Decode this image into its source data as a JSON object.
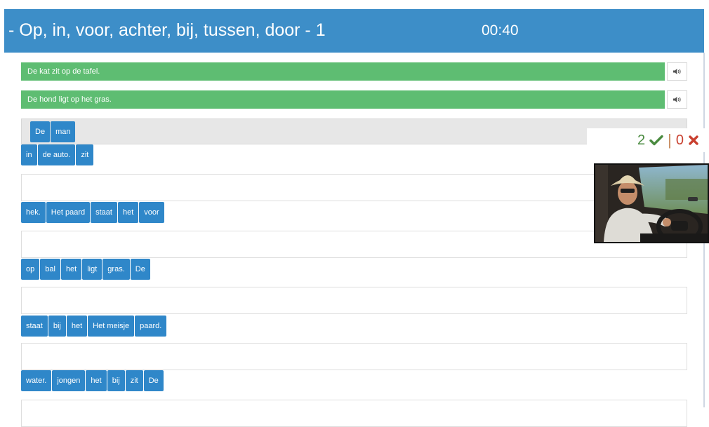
{
  "header": {
    "title": "- Op, in, voor, achter, bij, tussen, door - 1",
    "timer": "00:40"
  },
  "completed": [
    {
      "sentence": "De kat zit op de tafel."
    },
    {
      "sentence": "De hond ligt op het gras."
    }
  ],
  "active": {
    "placed": [
      "De",
      "man"
    ],
    "bank": [
      "in",
      "de auto.",
      "zit"
    ]
  },
  "exercises": [
    {
      "bank": [
        "hek.",
        "Het paard",
        "staat",
        "het",
        "voor"
      ]
    },
    {
      "bank": [
        "op",
        "bal",
        "het",
        "ligt",
        "gras.",
        "De"
      ]
    },
    {
      "bank": [
        "staat",
        "bij",
        "het",
        "Het meisje",
        "paard."
      ]
    },
    {
      "bank": [
        "water.",
        "jongen",
        "het",
        "bij",
        "zit",
        "De"
      ]
    }
  ],
  "score": {
    "correct": "2",
    "correct_icon": "check-icon",
    "separator": "|",
    "wrong": "0",
    "wrong_icon": "cross-icon"
  },
  "colors": {
    "header": "#3d8ec8",
    "chip": "#2f87c9",
    "success": "#5ebd72"
  }
}
